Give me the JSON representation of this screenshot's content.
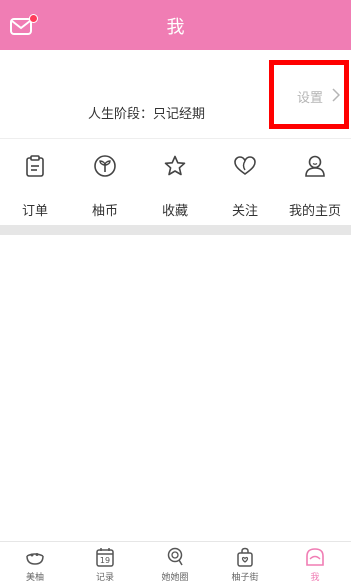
{
  "header": {
    "title": "我"
  },
  "profile": {
    "stage_text": "人生阶段：只记经期",
    "settings_label": "设置"
  },
  "menu": {
    "items": [
      {
        "label": "订单",
        "icon": "clipboard-icon"
      },
      {
        "label": "柚币",
        "icon": "coin-sprout-icon"
      },
      {
        "label": "收藏",
        "icon": "star-icon"
      },
      {
        "label": "关注",
        "icon": "heart-icon"
      },
      {
        "label": "我的主页",
        "icon": "user-icon"
      }
    ]
  },
  "tabbar": {
    "items": [
      {
        "label": "美柚",
        "icon": "bowl-icon"
      },
      {
        "label": "记录",
        "icon": "calendar-icon",
        "day": "19"
      },
      {
        "label": "她她圈",
        "icon": "lollipop-icon"
      },
      {
        "label": "柚子街",
        "icon": "shopping-bag-icon"
      },
      {
        "label": "我",
        "icon": "house-face-icon"
      }
    ],
    "active_index": 4
  },
  "colors": {
    "accent": "#f07db4",
    "highlight_box": "#ff0000"
  }
}
